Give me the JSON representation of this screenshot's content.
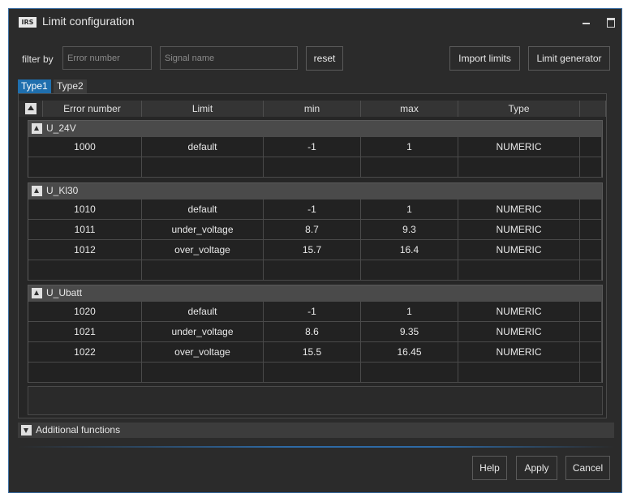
{
  "window": {
    "title": "Limit configuration",
    "logo_text": "IRS"
  },
  "filter": {
    "label": "filter by",
    "error_placeholder": "Error number",
    "signal_placeholder": "Signal name",
    "reset_label": "reset"
  },
  "toolbar": {
    "import_label": "Import limits",
    "generator_label": "Limit generator"
  },
  "tabs": [
    {
      "label": "Type1",
      "active": true
    },
    {
      "label": "Type2",
      "active": false
    }
  ],
  "table": {
    "columns": [
      "Error number",
      "Limit",
      "min",
      "max",
      "Type"
    ],
    "groups": [
      {
        "name": "U_24V",
        "rows": [
          {
            "error": "1000",
            "limit": "default",
            "min": "-1",
            "max": "1",
            "type": "NUMERIC"
          }
        ]
      },
      {
        "name": "U_Kl30",
        "rows": [
          {
            "error": "1010",
            "limit": "default",
            "min": "-1",
            "max": "1",
            "type": "NUMERIC"
          },
          {
            "error": "1011",
            "limit": "under_voltage",
            "min": "8.7",
            "max": "9.3",
            "type": "NUMERIC"
          },
          {
            "error": "1012",
            "limit": "over_voltage",
            "min": "15.7",
            "max": "16.4",
            "type": "NUMERIC"
          }
        ]
      },
      {
        "name": "U_Ubatt",
        "rows": [
          {
            "error": "1020",
            "limit": "default",
            "min": "-1",
            "max": "1",
            "type": "NUMERIC"
          },
          {
            "error": "1021",
            "limit": "under_voltage",
            "min": "8.6",
            "max": "9.35",
            "type": "NUMERIC"
          },
          {
            "error": "1022",
            "limit": "over_voltage",
            "min": "15.5",
            "max": "16.45",
            "type": "NUMERIC"
          }
        ]
      }
    ]
  },
  "additional": {
    "label": "Additional functions"
  },
  "footer": {
    "help_label": "Help",
    "apply_label": "Apply",
    "cancel_label": "Cancel"
  },
  "colors": {
    "accent": "#1f6fae",
    "background": "#2b2b2b",
    "group_header": "#4a4a4a"
  }
}
